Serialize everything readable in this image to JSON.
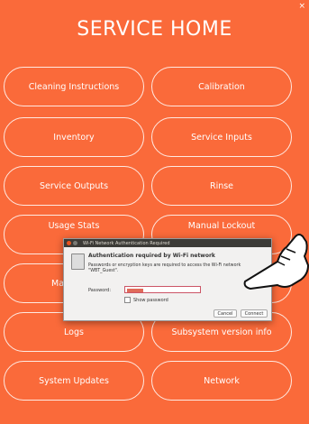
{
  "window": {
    "close_glyph": "×"
  },
  "page": {
    "title": "SERVICE HOME"
  },
  "menu": [
    {
      "label": "Cleaning Instructions"
    },
    {
      "label": "Calibration"
    },
    {
      "label": "Inventory"
    },
    {
      "label": "Service Inputs"
    },
    {
      "label": "Service Outputs"
    },
    {
      "label": "Rinse"
    },
    {
      "label": "Usage Stats"
    },
    {
      "label": "Manual Lockout"
    },
    {
      "label": "Ma"
    },
    {
      "label": ""
    },
    {
      "label": "Logs"
    },
    {
      "label": "Subsystem version info"
    },
    {
      "label": "System Updates"
    },
    {
      "label": "Network"
    }
  ],
  "dialog": {
    "title": "Wi-Fi Network Authentication Required",
    "heading": "Authentication required by Wi-Fi network",
    "description": "Passwords or encryption keys are required to access the Wi-Fi network \"WBT_Guest\".",
    "password_label": "Password:",
    "show_password_label": "Show password",
    "cancel_label": "Cancel",
    "connect_label": "Connect"
  },
  "colors": {
    "background": "#FA6A3A",
    "dialog_titlebar": "#3C3B37"
  },
  "icons": {
    "pointer": "pointing-hand-icon",
    "wifi_lock": "wifi-lock-icon"
  }
}
